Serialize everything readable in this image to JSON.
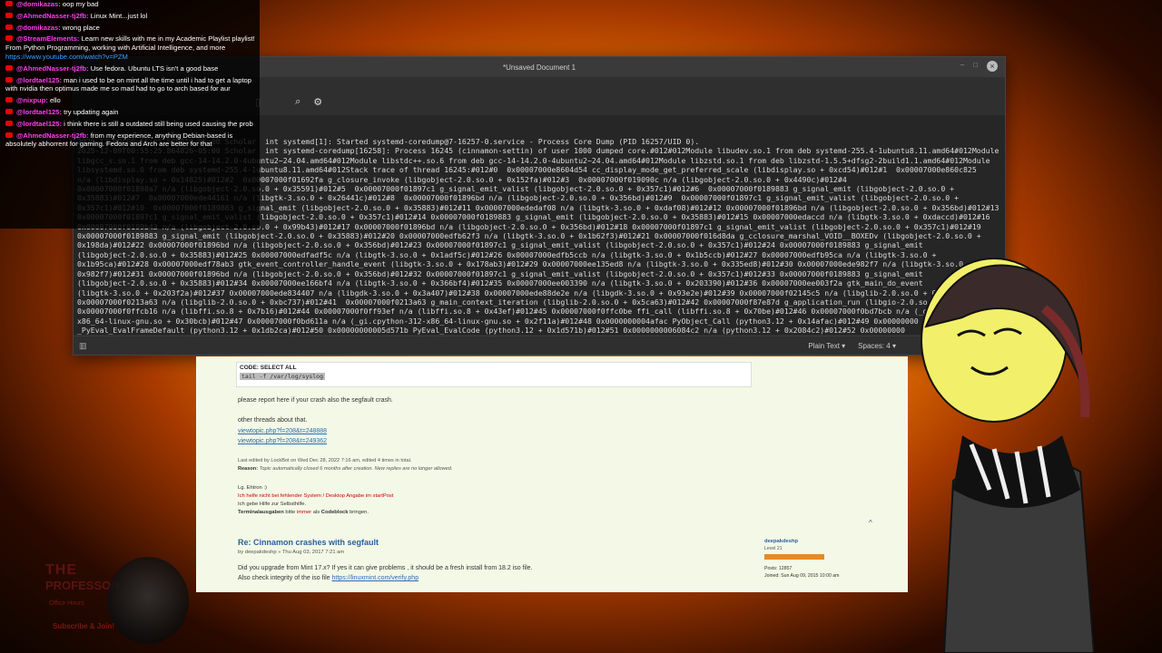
{
  "chat": {
    "messages": [
      {
        "user": "@domikazas:",
        "text": "oop my bad"
      },
      {
        "user": "@AhmedNasser-tj2fb:",
        "text": "Linux Mint...just lol"
      },
      {
        "user": "@domikazas:",
        "text": "wrong place"
      },
      {
        "user": "@StreamElements:",
        "text": "Learn new skills with me in my Academic Playlist playlist! From Python Programming, working with Artificial Intelligence, and more",
        "link": "https://www.youtube.com/watch?v=PZM"
      },
      {
        "user": "@AhmedNasser-tj2fb:",
        "text": "Use fedora. Ubuntu LTS isn't a good base"
      },
      {
        "user": "@lordtael125:",
        "text": "man i used to be on mint all the time until i had to get a laptop with nvidia then optimus made me so mad had to go to arch based for aur"
      },
      {
        "user": "@nixpup:",
        "text": "ello"
      },
      {
        "user": "@lordtael125:",
        "text": "try updating again"
      },
      {
        "user": "@lordtael125:",
        "text": "i think there is still a outdated still being used causing the prob"
      },
      {
        "user": "@AhmedNasser-tj2fb:",
        "text": "from my experience, anything Debian-based is absolutely abhorrent for gaming. Fedora and Arch are better for that"
      }
    ]
  },
  "editor": {
    "title": "*Unsaved Document 1",
    "status_language": "Plain Text",
    "status_spaces": "Spaces: 4",
    "lines": [
      "2025-12-09T00:55:25.578010-05:00 Scholar  int systemd[1]: Started systemd-coredump@7-16257-0.service - Process Core Dump (PID 16257/UID 0).",
      "2025-12-09T00:55:25.864826-05:00 Scholar  int systemd-coredump[16258]: Process 16245 (cinnamon-settin) of user 1000 dumped core.#012#012Module libudev.so.1 from deb systemd-255.4-1ubuntu8.11.amd64#012Module",
      "libgcc_s.so.1 from deb gcc-14-14.2.0-4ubuntu2~24.04.amd64#012Module libstdc++.so.6 from deb gcc-14-14.2.0-4ubuntu2~24.04.amd64#012Module libzstd.so.1 from deb libzstd-1.5.5+dfsg2-2build1.1.amd64#012Module",
      "libsystemd.so.0 from deb systemd-255.4-1ubuntu8.11.amd64#012Stack trace of thread 16245:#012#0  0x00007000e8604d54 cc_display_mode_get_preferred_scale (libdisplay.so + 0xcd54)#012#1  0x00007000e860c825",
      "n/a (libdisplay.so + 0x14825)#012#2  0x00007000f01692fa g_closure_invoke (libgobject-2.0.so.0 + 0x152fa)#012#3  0x00007000f019090c n/a (libgobject-2.0.so.0 + 0x4490c)#012#4",
      "0x00007000f01898a7 n/a (libgobject-2.0.so.0 + 0x35591)#012#5  0x00007000f01897c1 g_signal_emit_valist (libgobject-2.0.so.0 + 0x357c1)#012#6  0x00007000f0189883 g_signal_emit (libgobject-2.0.so.0 +",
      "0x35883)#012#7  0x00007000ede44161 n/a (libgtk-3.so.0 + 0x26441c)#012#8  0x00007000f01896bd n/a (libgobject-2.0.so.0 + 0x356bd)#012#9  0x00007000f01897c1 g_signal_emit_valist (libgobject-2.0.so.0 +",
      "0x357c1)#012#10  0x00007000f0189883 g_signal_emit (libgobject-2.0.so.0 + 0x35883)#012#11 0x00007000ededaf08 n/a (libgtk-3.so.0 + 0xdaf08)#012#12 0x00007000f01896bd n/a (libgobject-2.0.so.0 + 0x356bd)#012#13",
      "0x00007000f01897c1 g_signal_emit_valist (libgobject-2.0.so.0 + 0x357c1)#012#14 0x00007000f0189883 g_signal_emit (libgobject-2.0.so.0 + 0x35883)#012#15 0x00007000edaccd n/a (libgtk-3.so.0 + 0xdaccd)#012#16",
      "0x00007000f0199b43 n/a (libgobject-2.0.so.0 + 0x99b43)#012#17 0x00007000f01896bd n/a (libgobject-2.0.so.0 + 0x356bd)#012#18 0x00007000f01897c1 g_signal_emit_valist (libgobject-2.0.so.0 + 0x357c1)#012#19",
      "0x00007000f0189883 g_signal_emit (libgobject-2.0.so.0 + 0x35883)#012#20 0x00007000edfb62f3 n/a (libgtk-3.so.0 + 0x1b62f3)#012#21 0x00007000f016d8da g_cclosure_marshal_VOID__BOXEDv (libgobject-2.0.so.0 +",
      "0x198da)#012#22 0x00007000f01896bd n/a (libgobject-2.0.so.0 + 0x356bd)#012#23 0x00007000f01897c1 g_signal_emit_valist (libgobject-2.0.so.0 + 0x357c1)#012#24 0x00007000f0189883 g_signal_emit",
      "(libgobject-2.0.so.0 + 0x35883)#012#25 0x00007000edfadf5c n/a (libgtk-3.so.0 + 0x1adf5c)#012#26 0x00007000edfb5ccb n/a (libgtk-3.so.0 + 0x1b5ccb)#012#27 0x00007000edfb95ca n/a (libgtk-3.so.0 +",
      "0x1b95ca)#012#28 0x00007000edf78ab3 gtk_event_controller_handle_event (libgtk-3.so.0 + 0x178ab3)#012#29 0x00007000ee135ed8 n/a (libgtk-3.so.0 + 0x335ed8)#012#30 0x00007000ede982f7 n/a (libgtk-3.so.0 +",
      "0x982f7)#012#31 0x00007000f01896bd n/a (libgobject-2.0.so.0 + 0x356bd)#012#32 0x00007000f01897c1 g_signal_emit_valist (libgobject-2.0.so.0 + 0x357c1)#012#33 0x00007000f0189883 g_signal_emit",
      "(libgobject-2.0.so.0 + 0x35883)#012#34 0x00007000ee166bf4 n/a (libgtk-3.so.0 + 0x366bf4)#012#35 0x00007000ee003390 n/a (libgtk-3.so.0 + 0x203390)#012#36 0x00007000ee003f2a gtk_main_do_event",
      "(libgtk-3.so.0 + 0x203f2a)#012#37 0x00007000ede834407 n/a (libgdk-3.so.0 + 0x3a407)#012#38 0x00007000ede88de2e n/a (libgdk-3.so.0 + 0x93e2e)#012#39 0x00007000f02145c5 n/a (libglib-2.0.so.0 + 0x5d5c5)#012#40",
      "0x00007000f0213a63 n/a (libglib-2.0.so.0 + 0xbc737)#012#41  0x00007000f0213a63 g_main_context_iteration (libglib-2.0.so.0 + 0x5ca63)#012#42 0x00007000f87e87d g_application_run (libgio-2.0.so.0 + 0xe787d)#012#43",
      "0x00007000f0ffcb16 n/a (libffi.so.8 + 0x7b16)#012#44 0x00007000f0ff93ef n/a (libffi.so.8 + 0x43ef)#012#45 0x00007000f0ffc0be ffi_call (libffi.so.8 + 0x70be)#012#46 0x00007000f0bd7bcb n/a (_gi.cpython-312-",
      "x86_64-linux-gnu.so + 0x30bcb)#012#47 0x00007000f0bd611a n/a (_gi.cpython-312-x86_64-linux-gnu.so + 0x2f11a)#012#48 0x0000000004afac PyObject_Call (python3.12 + 0x14afac)#012#49 0x00000000",
      "_PyEval_EvalFrameDefault (python3.12 + 0x1db2ca)#012#50 0x00000000005d571b PyEval_EvalCode (python3.12 + 0x1d571b)#012#51 0x0000000006084c2 n/a (python3.12 + 0x2084c2)#012#52 0x00000000"
    ]
  },
  "forum": {
    "code_header": "CODE: SELECT ALL",
    "code_cmd": "tail -f /var/log/syslog",
    "report_text": "please report here if your crash also the segfault crash.",
    "other_threads": "other threads about that.",
    "thread_links": [
      "viewtopic.php?f=208&t=248888",
      "viewtopic.php?f=208&t=249362"
    ],
    "edited": "Last edited by LockBot on Wed Dec 28, 2022 7:16 am, edited 4 times in total.",
    "reason_label": "Reason:",
    "reason_text": "Topic automatically closed 6 months after creation. New replies are no longer allowed.",
    "sig_line1": "Lg. Ehtron :)",
    "sig_line2": "Ich helfe nicht bei fehlender System / Desktop Angabe im startPost",
    "sig_line3": "Ich gebe Hilfe zur Selbsthilfe.",
    "sig_line4_a": "Terminalausgaben",
    "sig_line4_b": "bitte",
    "sig_line4_c": "immer",
    "sig_line4_d": "als",
    "sig_line4_e": "Codeblock",
    "sig_line4_f": "bringen.",
    "post_title": "Re: Cinnamon crashes with segfault",
    "post_by": "by deepakdeshp » Thu Aug 03, 2017 7:21 am",
    "post_body": "Did you upgrade from Mint 17.x? If yes it can give problems , it should be a fresh install from 18.2 iso file.",
    "post_body2": "Also check integrity of the iso file",
    "post_link": "https://linuxmint.com/verify.php",
    "author_name": "deepakdeshp",
    "author_level": "Level 21",
    "author_posts": "Posts: 12857",
    "author_joined": "Joined: Sun Aug 09, 2015 10:00 am",
    "top_icon": "^"
  },
  "overlay": {
    "logo_title": "THE",
    "logo_title2": "PROFESSOR",
    "logo_sub1": "Office Hours",
    "logo_sub2": "Subscribe & Join!"
  },
  "colors": {
    "accent_user": "#ff3df5",
    "forum_bg": "#f3f9e6",
    "link": "#2b6cb0"
  }
}
